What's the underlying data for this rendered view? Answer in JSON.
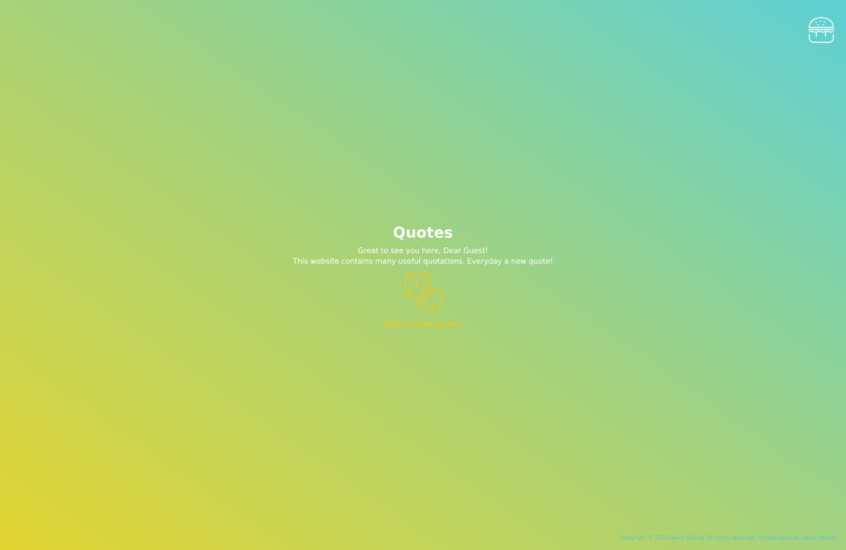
{
  "page": {
    "title": "Quotes",
    "greeting": "Great to see you here, Dear Guest!",
    "description": "This website contains many useful quotations. Everyday a new quote!"
  },
  "header": {
    "menu_icon": "burger-icon"
  },
  "random_quote": {
    "icon": "dice-icon",
    "label": "Pull random quote!"
  },
  "footer": {
    "copyright": "Copyright © 2019 Jakub Chorąż All rights reserved. Photography by",
    "photographer": "Jakub Chorąż"
  },
  "colors": {
    "gradient_start": "#e3d531",
    "gradient_end": "#5dcfd5",
    "accent": "#e6c92c",
    "text": "#ffffff",
    "footer_text": "#55c6c9"
  }
}
